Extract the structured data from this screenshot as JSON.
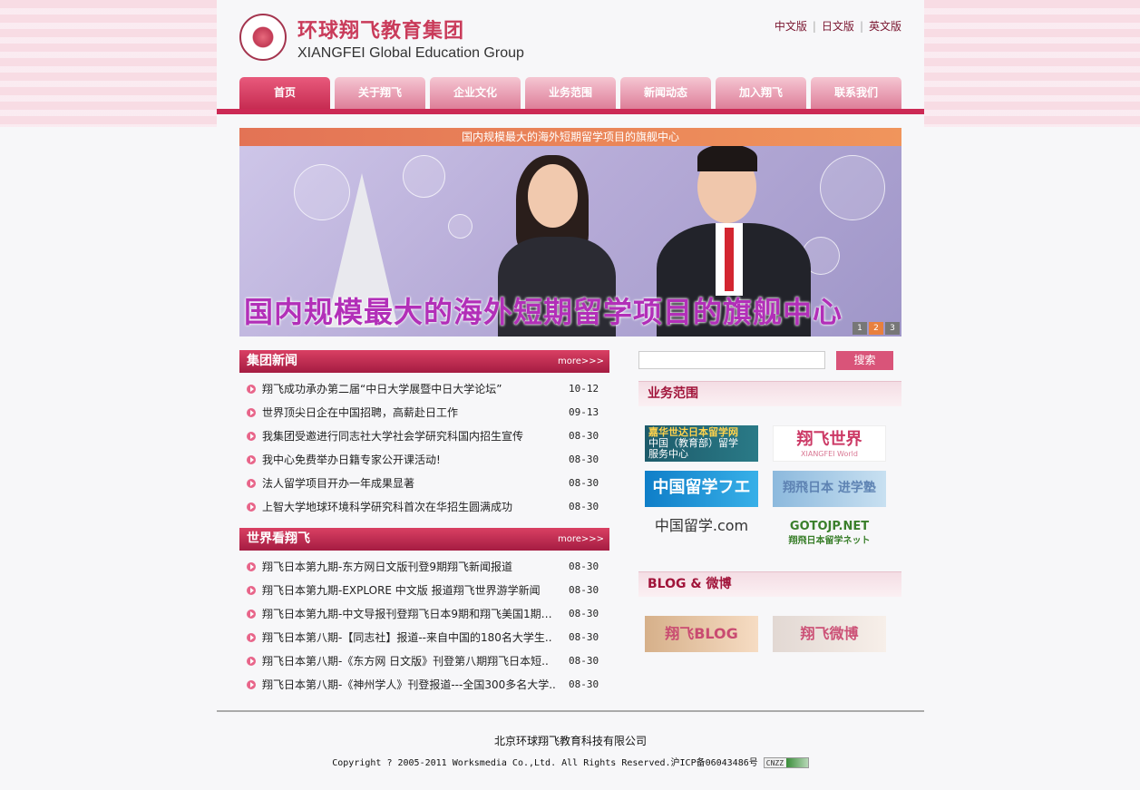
{
  "header": {
    "logo_cn": "环球翔飞教育集团",
    "logo_en": "XIANGFEI Global Education Group",
    "languages": [
      "中文版",
      "日文版",
      "英文版"
    ]
  },
  "nav": {
    "items": [
      "首页",
      "关于翔飞",
      "企业文化",
      "业务范围",
      "新闻动态",
      "加入翔飞",
      "联系我们"
    ],
    "active_index": 0
  },
  "banner": {
    "top_text": "国内规模最大的海外短期留学项目的旗舰中心",
    "slogan": "国内规模最大的海外短期留学项目的旗舰中心",
    "pages": [
      "1",
      "2",
      "3"
    ],
    "active_page": "2"
  },
  "group_news": {
    "title": "集团新闻",
    "more": "more>>>",
    "items": [
      {
        "title": "翔飞成功承办第二届“中日大学展暨中日大学论坛”",
        "date": "10-12"
      },
      {
        "title": "世界顶尖日企在中国招聘，高薪赴日工作",
        "date": "09-13"
      },
      {
        "title": "我集团受邀进行同志社大学社会学研究科国内招生宣传",
        "date": "08-30"
      },
      {
        "title": "我中心免费举办日籍专家公开课活动!",
        "date": "08-30"
      },
      {
        "title": "法人留学项目开办一年成果显著",
        "date": "08-30"
      },
      {
        "title": "上智大学地球环境科学研究科首次在华招生圆满成功",
        "date": "08-30"
      }
    ]
  },
  "world_news": {
    "title": "世界看翔飞",
    "more": "more>>>",
    "items": [
      {
        "title": "翔飞日本第九期-东方网日文版刊登9期翔飞新闻报道",
        "date": "08-30"
      },
      {
        "title": "翔飞日本第九期-EXPLORE 中文版 报道翔飞世界游学新闻",
        "date": "08-30"
      },
      {
        "title": "翔飞日本第九期-中文导报刊登翔飞日本9期和翔飞美国1期新..",
        "date": "08-30"
      },
      {
        "title": "翔飞日本第八期-【同志社】报道--来自中国的180名大学生..",
        "date": "08-30"
      },
      {
        "title": "翔飞日本第八期-《东方网 日文版》刊登第八期翔飞日本短..",
        "date": "08-30"
      },
      {
        "title": "翔飞日本第八期-《神州学人》刊登报道---全国300多名大学..",
        "date": "08-30"
      }
    ]
  },
  "search": {
    "placeholder": "",
    "button": "搜索"
  },
  "business": {
    "title": "业务范围",
    "badges": [
      {
        "line1": "嘉华世达日本留学网",
        "line2": "中国（教育部）留学",
        "line3": "服务中心"
      },
      {
        "text": "翔飞世界",
        "sub": "XIANGFEI World"
      },
      {
        "text": "中国留学フエア"
      },
      {
        "text": "翔飛日本 进学塾"
      },
      {
        "text": "中国留学.com"
      },
      {
        "text": "GOTOJP.NET",
        "sub": "翔飛日本留学ネット"
      }
    ]
  },
  "blog": {
    "title": "BLOG & 微博",
    "badges": [
      "翔飞BLOG",
      "翔飞微博"
    ]
  },
  "footer": {
    "company": "北京环球翔飞教育科技有限公司",
    "copyright": "Copyright ? 2005-2011 Worksmedia Co.,Ltd. All Rights Reserved.沪ICP备06043486号",
    "cnzz": "CNZZ"
  },
  "colors": {
    "brand": "#c72c52",
    "nav_inactive": "#e79bb0",
    "accent_orange": "#e8803e"
  }
}
